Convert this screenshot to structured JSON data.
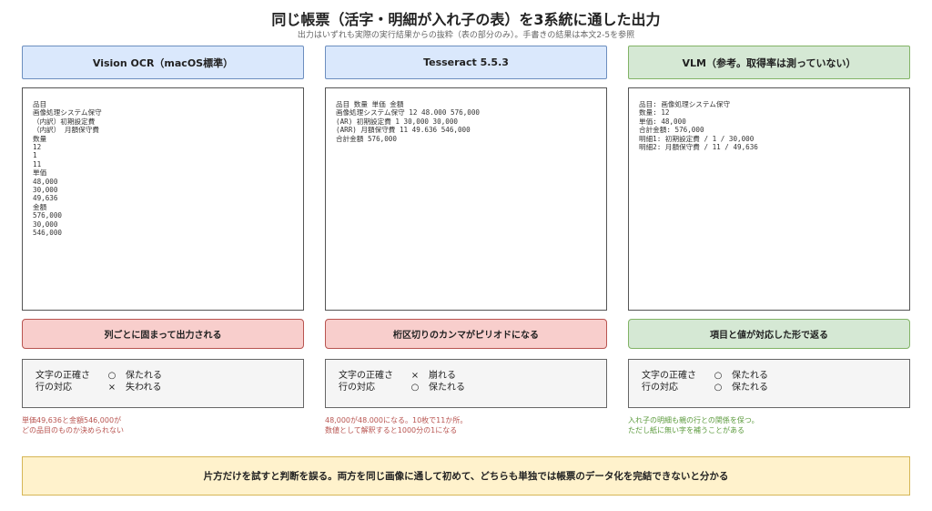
{
  "title": "同じ帳票（活字・明細が入れ子の表）を3系統に通した出力",
  "subtitle": "出力はいずれも実際の実行結果からの抜粋（表の部分のみ）。手書きの結果は本文2-5を参照",
  "columns": [
    {
      "header": "Vision OCR（macOS標準）",
      "output_lines": [
        "品目",
        "画像処理システム保守",
        "（内訳）初期設定費",
        "（内訳） 月額保守費",
        "数量",
        "12",
        "1",
        "11",
        "単価",
        "48,000",
        "30,000",
        "49,636",
        "金額",
        "576,000",
        "30,000",
        "546,000"
      ],
      "verdict": "列ごとに固まって出力される",
      "eval": {
        "rows": [
          {
            "label": "文字の正確さ",
            "mark": "○",
            "text": "保たれる"
          },
          {
            "label": "行の対応",
            "mark": "×",
            "text": "失われる"
          }
        ]
      },
      "note_lines": [
        "単価49,636と金額546,000が",
        "どの品目のものか決められない"
      ]
    },
    {
      "header": "Tesseract 5.5.3",
      "output_lines": [
        "品目 数量 単価 金額",
        "画像処理システム保守 12 48.000 576,000",
        "(AR) 初期設定費 1 30,000 30,000",
        "(ARR) 月額保守費 11 49.636 546,000",
        "合計金額 576,000"
      ],
      "verdict": "桁区切りのカンマがピリオドになる",
      "eval": {
        "rows": [
          {
            "label": "文字の正確さ",
            "mark": "×",
            "text": "崩れる"
          },
          {
            "label": "行の対応",
            "mark": "○",
            "text": "保たれる"
          }
        ]
      },
      "note_lines": [
        "48,000が48.000になる。10枚で11か所。",
        "数値として解釈すると1000分の1になる"
      ]
    },
    {
      "header": "VLM（参考。取得率は測っていない）",
      "output_lines": [
        "品目: 画像処理システム保守",
        "数量: 12",
        "単価: 48,000",
        "合計金額: 576,000",
        "明細1: 初期設定費 / 1 / 30,000",
        "明細2: 月額保守費 / 11 / 49,636"
      ],
      "verdict": "項目と値が対応した形で返る",
      "eval": {
        "rows": [
          {
            "label": "文字の正確さ",
            "mark": "○",
            "text": "保たれる"
          },
          {
            "label": "行の対応",
            "mark": "○",
            "text": "保たれる"
          }
        ]
      },
      "note_lines": [
        "入れ子の明細も親の行との関係を保つ。",
        "ただし紙に無い字を補うことがある"
      ]
    }
  ],
  "conclusion": "片方だけを試すと判断を誤る。両方を同じ画像に通して初めて、どちらも単独では帳票のデータ化を完結できないと分かる",
  "colors": {
    "header_blue": "#dae8fc",
    "header_green": "#d5e8d4",
    "verdict_red": "#f8cecc",
    "verdict_green": "#d5e8d4",
    "note_red": "#b85450",
    "note_green": "#5b9a3c",
    "conclusion_yellow": "#fff2cc"
  }
}
